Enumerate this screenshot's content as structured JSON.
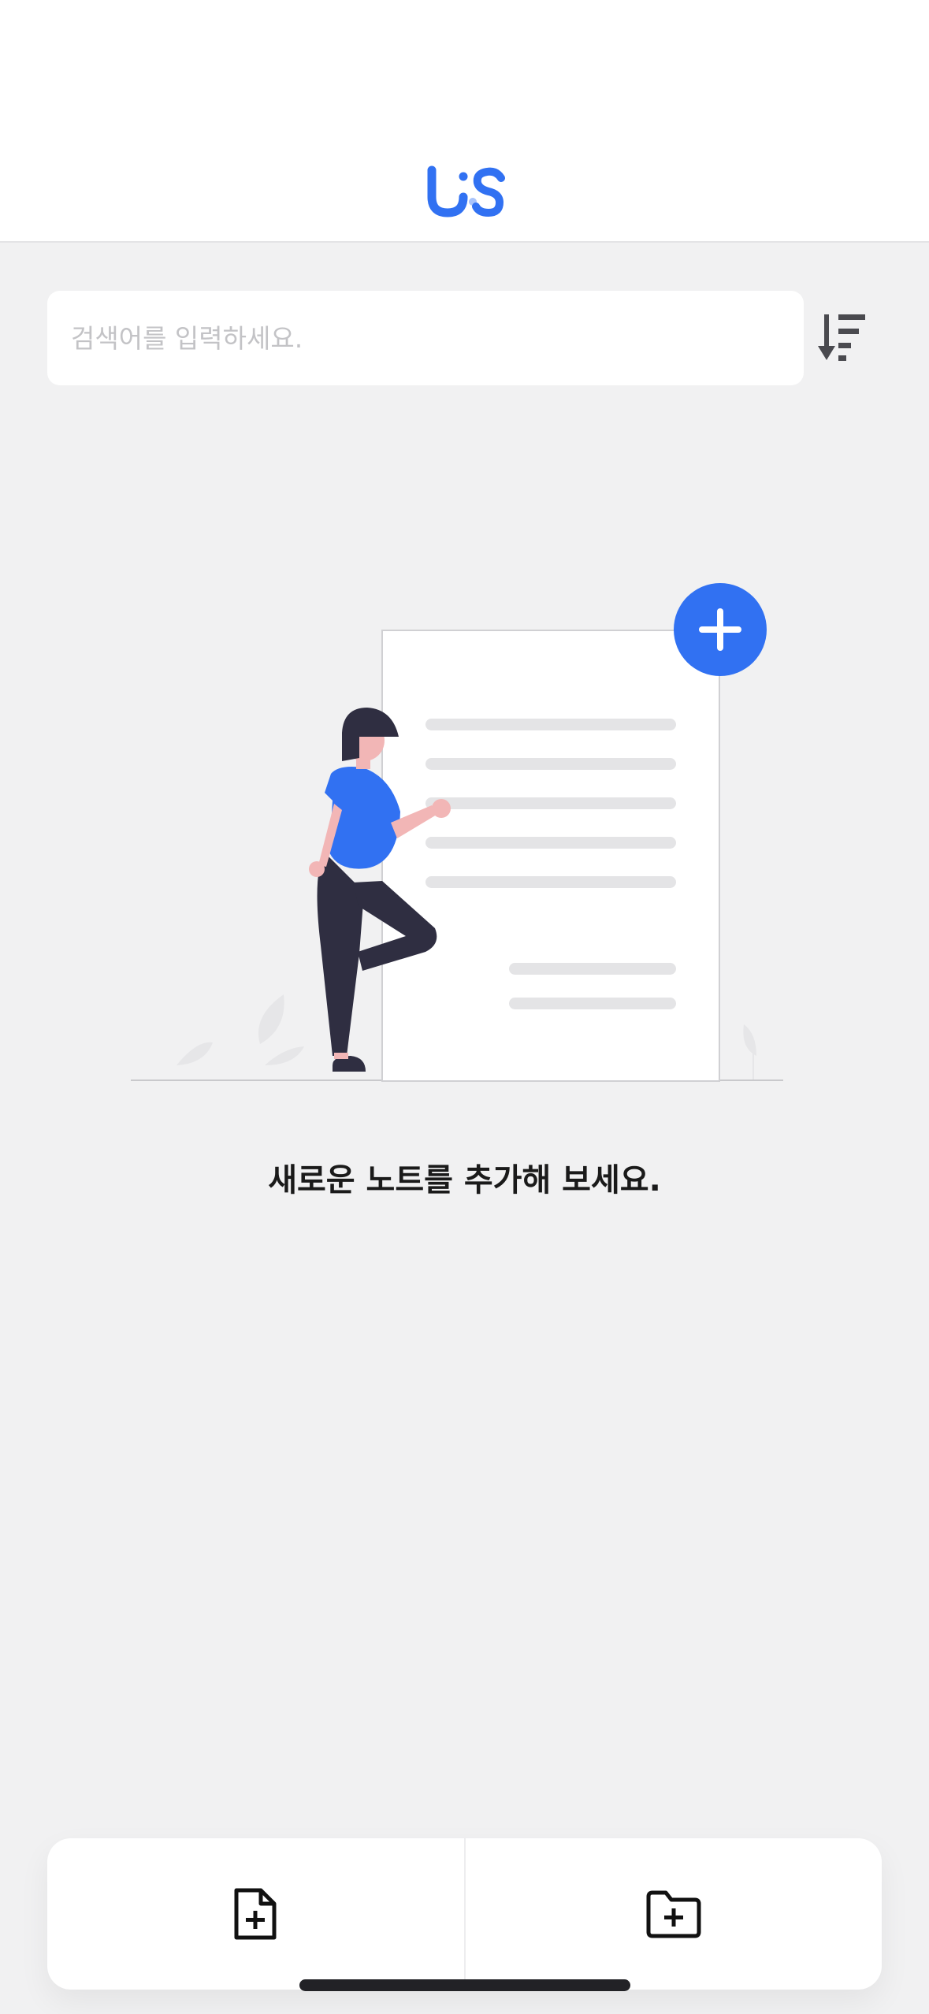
{
  "app": {
    "logo_text": "US"
  },
  "search": {
    "placeholder": "검색어를 입력하세요.",
    "value": ""
  },
  "empty_state": {
    "message": "새로운 노트를 추가해 보세요."
  },
  "icons": {
    "sort": "sort-descending-icon",
    "new_note": "file-plus-icon",
    "new_folder": "folder-plus-icon",
    "illustration_add": "plus-circle-icon"
  },
  "colors": {
    "accent": "#3171f2",
    "background": "#f1f1f2",
    "surface": "#ffffff",
    "placeholder": "#c3c3c6"
  }
}
